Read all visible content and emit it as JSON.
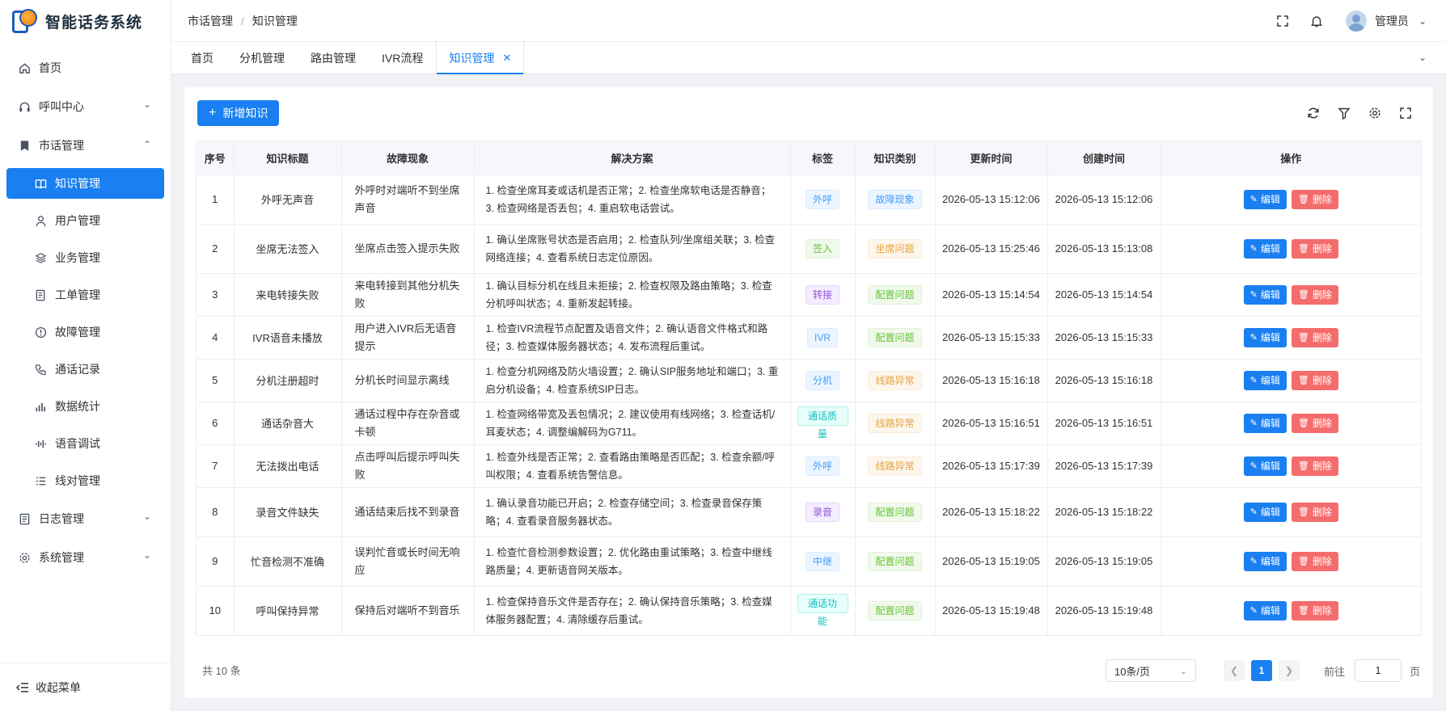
{
  "app": {
    "title": "智能话务系统"
  },
  "sidebar": {
    "items": [
      {
        "label": "首页",
        "icon": "home-icon"
      },
      {
        "label": "呼叫中心",
        "icon": "headset-icon"
      },
      {
        "label": "市话管理",
        "icon": "bookmark-icon"
      }
    ],
    "submenu": [
      {
        "label": "知识管理",
        "icon": "book-icon"
      },
      {
        "label": "用户管理",
        "icon": "user-icon"
      },
      {
        "label": "业务管理",
        "icon": "layers-icon"
      },
      {
        "label": "工单管理",
        "icon": "ticket-icon"
      },
      {
        "label": "故障管理",
        "icon": "alert-icon"
      },
      {
        "label": "通话记录",
        "icon": "phone-icon"
      },
      {
        "label": "数据统计",
        "icon": "bar-chart-icon"
      },
      {
        "label": "语音调试",
        "icon": "waveform-icon"
      },
      {
        "label": "线对管理",
        "icon": "list-icon"
      }
    ],
    "bottom_items": [
      {
        "label": "日志管理",
        "icon": "log-icon"
      },
      {
        "label": "系统管理",
        "icon": "gear-icon"
      }
    ],
    "collapse_label": "收起菜单"
  },
  "header": {
    "breadcrumb": [
      "市话管理",
      "知识管理"
    ],
    "user_name": "管理员"
  },
  "tabs": [
    {
      "label": "首页"
    },
    {
      "label": "分机管理"
    },
    {
      "label": "路由管理"
    },
    {
      "label": "IVR流程"
    },
    {
      "label": "知识管理",
      "active": true
    }
  ],
  "toolbar": {
    "add_label": "新增知识"
  },
  "table": {
    "columns": [
      "序号",
      "知识标题",
      "故障现象",
      "解决方案",
      "标签",
      "知识类别",
      "更新时间",
      "创建时间",
      "操作"
    ],
    "edit_label": "编辑",
    "delete_label": "删除",
    "rows": [
      {
        "no": "1",
        "title": "外呼无声音",
        "symptom": "外呼时对端听不到坐席声音",
        "solution": "1. 检查坐席耳麦或话机是否正常；2. 检查坐席软电话是否静音；3. 检查网络是否丢包；4. 重启软电话尝试。",
        "tag": "外呼",
        "tag_color": "blue",
        "category": "故障现象",
        "category_color": "blue",
        "updated": "2026-05-13 15:12:06",
        "created": "2026-05-13 15:12:06"
      },
      {
        "no": "2",
        "title": "坐席无法签入",
        "symptom": "坐席点击签入提示失败",
        "solution": "1. 确认坐席账号状态是否启用；2. 检查队列/坐席组关联；3. 检查网络连接；4. 查看系统日志定位原因。",
        "tag": "签入",
        "tag_color": "green",
        "category": "坐席问题",
        "category_color": "orange",
        "updated": "2026-05-13 15:25:46",
        "created": "2026-05-13 15:13:08"
      },
      {
        "no": "3",
        "title": "来电转接失败",
        "symptom": "来电转接到其他分机失败",
        "solution": "1. 确认目标分机在线且未拒接；2. 检查权限及路由策略；3. 检查分机呼叫状态；4. 重新发起转接。",
        "tag": "转接",
        "tag_color": "purple",
        "category": "配置问题",
        "category_color": "green",
        "updated": "2026-05-13 15:14:54",
        "created": "2026-05-13 15:14:54"
      },
      {
        "no": "4",
        "title": "IVR语音未播放",
        "symptom": "用户进入IVR后无语音提示",
        "solution": "1. 检查IVR流程节点配置及语音文件；2. 确认语音文件格式和路径；3. 检查媒体服务器状态；4. 发布流程后重试。",
        "tag": "IVR",
        "tag_color": "blue",
        "category": "配置问题",
        "category_color": "green",
        "updated": "2026-05-13 15:15:33",
        "created": "2026-05-13 15:15:33"
      },
      {
        "no": "5",
        "title": "分机注册超时",
        "symptom": "分机长时间显示离线",
        "solution": "1. 检查分机网络及防火墙设置；2. 确认SIP服务地址和端口；3. 重启分机设备；4. 检查系统SIP日志。",
        "tag": "分机",
        "tag_color": "blue",
        "category": "线路异常",
        "category_color": "orange",
        "updated": "2026-05-13 15:16:18",
        "created": "2026-05-13 15:16:18"
      },
      {
        "no": "6",
        "title": "通话杂音大",
        "symptom": "通话过程中存在杂音或卡顿",
        "solution": "1. 检查网络带宽及丢包情况；2. 建议使用有线网络；3. 检查话机/耳麦状态；4. 调整编解码为G711。",
        "tag": "通话质量",
        "tag_color": "cyan",
        "category": "线路异常",
        "category_color": "orange",
        "updated": "2026-05-13 15:16:51",
        "created": "2026-05-13 15:16:51"
      },
      {
        "no": "7",
        "title": "无法拨出电话",
        "symptom": "点击呼叫后提示呼叫失败",
        "solution": "1. 检查外线是否正常；2. 查看路由策略是否匹配；3. 检查余额/呼叫权限；4. 查看系统告警信息。",
        "tag": "外呼",
        "tag_color": "blue",
        "category": "线路异常",
        "category_color": "orange",
        "updated": "2026-05-13 15:17:39",
        "created": "2026-05-13 15:17:39"
      },
      {
        "no": "8",
        "title": "录音文件缺失",
        "symptom": "通话结束后找不到录音",
        "solution": "1. 确认录音功能已开启；2. 检查存储空间；3. 检查录音保存策略；4. 查看录音服务器状态。",
        "tag": "录音",
        "tag_color": "purple",
        "category": "配置问题",
        "category_color": "green",
        "updated": "2026-05-13 15:18:22",
        "created": "2026-05-13 15:18:22"
      },
      {
        "no": "9",
        "title": "忙音检测不准确",
        "symptom": "误判忙音或长时间无响应",
        "solution": "1. 检查忙音检测参数设置；2. 优化路由重试策略；3. 检查中继线路质量；4. 更新语音网关版本。",
        "tag": "中继",
        "tag_color": "blue",
        "category": "配置问题",
        "category_color": "green",
        "updated": "2026-05-13 15:19:05",
        "created": "2026-05-13 15:19:05"
      },
      {
        "no": "10",
        "title": "呼叫保持异常",
        "symptom": "保持后对端听不到音乐",
        "solution": "1. 检查保持音乐文件是否存在；2. 确认保持音乐策略；3. 检查媒体服务器配置；4. 清除缓存后重试。",
        "tag": "通话功能",
        "tag_color": "cyan",
        "category": "配置问题",
        "category_color": "green",
        "updated": "2026-05-13 15:19:48",
        "created": "2026-05-13 15:19:48"
      }
    ]
  },
  "pagination": {
    "total_label": "共 10 条",
    "page_size": "10条/页",
    "current_page": "1",
    "goto_label": "前往",
    "goto_value": "1",
    "page_suffix": "页"
  },
  "colors": {
    "primary": "#1a7ff0",
    "danger": "#f56c6c"
  }
}
